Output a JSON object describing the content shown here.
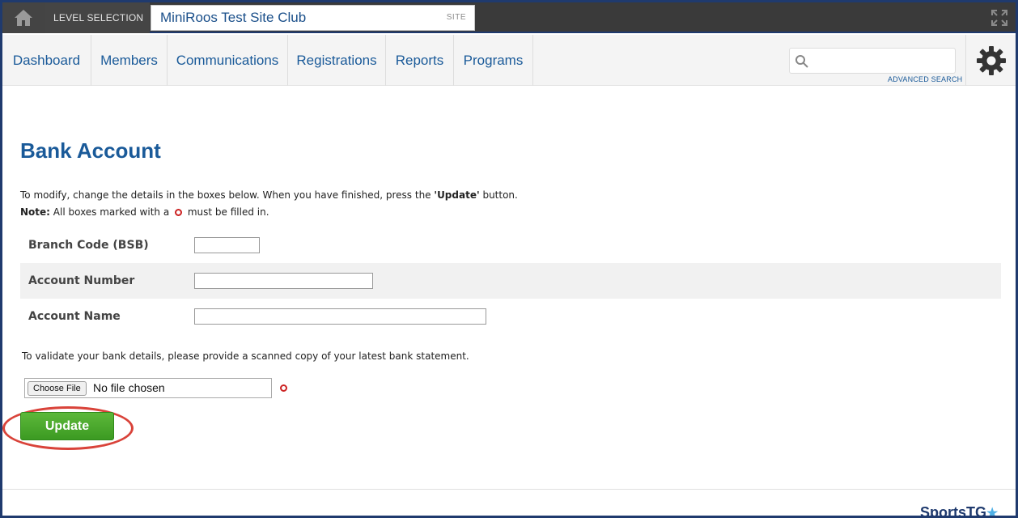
{
  "topbar": {
    "home_icon": "home-icon",
    "level_label": "LEVEL SELECTION",
    "site_name": "MiniRoos Test Site Club",
    "site_tag": "SITE",
    "expand_icon": "expand-icon"
  },
  "nav": {
    "items": [
      {
        "label": "Dashboard"
      },
      {
        "label": "Members"
      },
      {
        "label": "Communications"
      },
      {
        "label": "Registrations"
      },
      {
        "label": "Reports"
      },
      {
        "label": "Programs"
      }
    ],
    "search_placeholder": "",
    "search_value": "",
    "advanced_search": "ADVANCED SEARCH",
    "settings_icon": "gear-icon"
  },
  "page": {
    "title": "Bank Account",
    "intro_prefix": "To modify, change the details in the boxes below. When you have finished, press the ",
    "intro_button_ref": "'Update'",
    "intro_suffix": " button.",
    "note_label": "Note:",
    "note_prefix": " All boxes marked with a",
    "note_suffix": "must be filled in."
  },
  "form": {
    "fields": [
      {
        "label": "Branch Code (BSB)",
        "value": ""
      },
      {
        "label": "Account Number",
        "value": ""
      },
      {
        "label": "Account Name",
        "value": ""
      }
    ],
    "validate_text": "To validate your bank details, please provide a scanned copy of your latest bank statement.",
    "choose_file_label": "Choose File",
    "file_status": "No file chosen",
    "update_label": "Update"
  },
  "footer": {
    "logo_text": "SportsTG"
  },
  "colors": {
    "brand_blue": "#1a5a99",
    "update_green": "#4aa82c",
    "required_red": "#cc2222",
    "highlight_red": "#d9433a"
  }
}
